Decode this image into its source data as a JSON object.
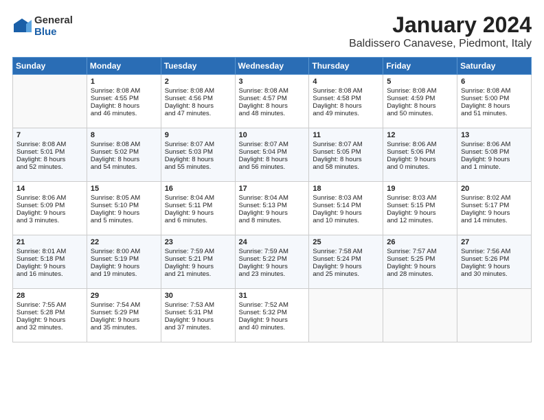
{
  "app": {
    "logo_general": "General",
    "logo_blue": "Blue"
  },
  "header": {
    "title": "January 2024",
    "subtitle": "Baldissero Canavese, Piedmont, Italy"
  },
  "calendar": {
    "days_of_week": [
      "Sunday",
      "Monday",
      "Tuesday",
      "Wednesday",
      "Thursday",
      "Friday",
      "Saturday"
    ],
    "weeks": [
      [
        {
          "day": "",
          "info": ""
        },
        {
          "day": "1",
          "info": "Sunrise: 8:08 AM\nSunset: 4:55 PM\nDaylight: 8 hours\nand 46 minutes."
        },
        {
          "day": "2",
          "info": "Sunrise: 8:08 AM\nSunset: 4:56 PM\nDaylight: 8 hours\nand 47 minutes."
        },
        {
          "day": "3",
          "info": "Sunrise: 8:08 AM\nSunset: 4:57 PM\nDaylight: 8 hours\nand 48 minutes."
        },
        {
          "day": "4",
          "info": "Sunrise: 8:08 AM\nSunset: 4:58 PM\nDaylight: 8 hours\nand 49 minutes."
        },
        {
          "day": "5",
          "info": "Sunrise: 8:08 AM\nSunset: 4:59 PM\nDaylight: 8 hours\nand 50 minutes."
        },
        {
          "day": "6",
          "info": "Sunrise: 8:08 AM\nSunset: 5:00 PM\nDaylight: 8 hours\nand 51 minutes."
        }
      ],
      [
        {
          "day": "7",
          "info": "Sunrise: 8:08 AM\nSunset: 5:01 PM\nDaylight: 8 hours\nand 52 minutes."
        },
        {
          "day": "8",
          "info": "Sunrise: 8:08 AM\nSunset: 5:02 PM\nDaylight: 8 hours\nand 54 minutes."
        },
        {
          "day": "9",
          "info": "Sunrise: 8:07 AM\nSunset: 5:03 PM\nDaylight: 8 hours\nand 55 minutes."
        },
        {
          "day": "10",
          "info": "Sunrise: 8:07 AM\nSunset: 5:04 PM\nDaylight: 8 hours\nand 56 minutes."
        },
        {
          "day": "11",
          "info": "Sunrise: 8:07 AM\nSunset: 5:05 PM\nDaylight: 8 hours\nand 58 minutes."
        },
        {
          "day": "12",
          "info": "Sunrise: 8:06 AM\nSunset: 5:06 PM\nDaylight: 9 hours\nand 0 minutes."
        },
        {
          "day": "13",
          "info": "Sunrise: 8:06 AM\nSunset: 5:08 PM\nDaylight: 9 hours\nand 1 minute."
        }
      ],
      [
        {
          "day": "14",
          "info": "Sunrise: 8:06 AM\nSunset: 5:09 PM\nDaylight: 9 hours\nand 3 minutes."
        },
        {
          "day": "15",
          "info": "Sunrise: 8:05 AM\nSunset: 5:10 PM\nDaylight: 9 hours\nand 5 minutes."
        },
        {
          "day": "16",
          "info": "Sunrise: 8:04 AM\nSunset: 5:11 PM\nDaylight: 9 hours\nand 6 minutes."
        },
        {
          "day": "17",
          "info": "Sunrise: 8:04 AM\nSunset: 5:13 PM\nDaylight: 9 hours\nand 8 minutes."
        },
        {
          "day": "18",
          "info": "Sunrise: 8:03 AM\nSunset: 5:14 PM\nDaylight: 9 hours\nand 10 minutes."
        },
        {
          "day": "19",
          "info": "Sunrise: 8:03 AM\nSunset: 5:15 PM\nDaylight: 9 hours\nand 12 minutes."
        },
        {
          "day": "20",
          "info": "Sunrise: 8:02 AM\nSunset: 5:17 PM\nDaylight: 9 hours\nand 14 minutes."
        }
      ],
      [
        {
          "day": "21",
          "info": "Sunrise: 8:01 AM\nSunset: 5:18 PM\nDaylight: 9 hours\nand 16 minutes."
        },
        {
          "day": "22",
          "info": "Sunrise: 8:00 AM\nSunset: 5:19 PM\nDaylight: 9 hours\nand 19 minutes."
        },
        {
          "day": "23",
          "info": "Sunrise: 7:59 AM\nSunset: 5:21 PM\nDaylight: 9 hours\nand 21 minutes."
        },
        {
          "day": "24",
          "info": "Sunrise: 7:59 AM\nSunset: 5:22 PM\nDaylight: 9 hours\nand 23 minutes."
        },
        {
          "day": "25",
          "info": "Sunrise: 7:58 AM\nSunset: 5:24 PM\nDaylight: 9 hours\nand 25 minutes."
        },
        {
          "day": "26",
          "info": "Sunrise: 7:57 AM\nSunset: 5:25 PM\nDaylight: 9 hours\nand 28 minutes."
        },
        {
          "day": "27",
          "info": "Sunrise: 7:56 AM\nSunset: 5:26 PM\nDaylight: 9 hours\nand 30 minutes."
        }
      ],
      [
        {
          "day": "28",
          "info": "Sunrise: 7:55 AM\nSunset: 5:28 PM\nDaylight: 9 hours\nand 32 minutes."
        },
        {
          "day": "29",
          "info": "Sunrise: 7:54 AM\nSunset: 5:29 PM\nDaylight: 9 hours\nand 35 minutes."
        },
        {
          "day": "30",
          "info": "Sunrise: 7:53 AM\nSunset: 5:31 PM\nDaylight: 9 hours\nand 37 minutes."
        },
        {
          "day": "31",
          "info": "Sunrise: 7:52 AM\nSunset: 5:32 PM\nDaylight: 9 hours\nand 40 minutes."
        },
        {
          "day": "",
          "info": ""
        },
        {
          "day": "",
          "info": ""
        },
        {
          "day": "",
          "info": ""
        }
      ]
    ]
  }
}
